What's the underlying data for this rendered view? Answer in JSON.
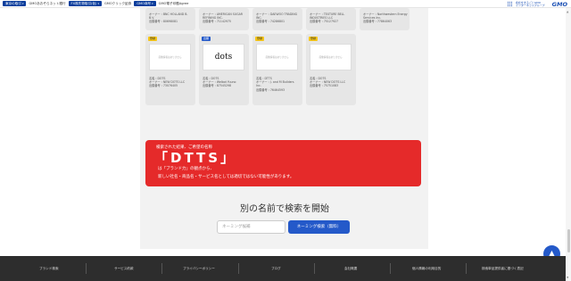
{
  "topbar": {
    "items": [
      {
        "label": "東京の取引",
        "caret": "▾"
      },
      {
        "label": "GMOあおぞらネット銀行",
        "caret": ""
      },
      {
        "label": "FX株先物取引(仮)",
        "caret": "▾"
      },
      {
        "label": "GMOクリック証券",
        "caret": ""
      },
      {
        "label": "GMO商号",
        "caret": "▾"
      },
      {
        "label": "GMO電子印鑑Agree",
        "caret": ""
      }
    ],
    "brand_text_line1": "会社をまるごとGMO",
    "brand_text_line2": "インターネットグループ",
    "brand_logo": "GMO"
  },
  "cards_top": [
    {
      "lines": [
        "オーナー : BNC HOLLAND B.",
        "B.V.",
        "出願番号 : 80698081"
      ]
    },
    {
      "lines": [
        "オーナー : AMERICAN SUGAR",
        "REFINING INC.",
        "出願番号 : 71142975"
      ]
    },
    {
      "lines": [
        "オーナー : DAEWOO TRADING",
        "INC.",
        "出願番号 : 74286801"
      ]
    },
    {
      "lines": [
        "オーナー : TEXTURE BELL",
        "INDUSTRIES LLC",
        "出願番号 : 75127927"
      ]
    },
    {
      "lines": [
        "オーナー : Northwestern Energy",
        "Services Inc.",
        "出願番号 : 77864063"
      ]
    }
  ],
  "cards_bottom": [
    {
      "badge": "登録",
      "badge_color": "yellow",
      "logo": "",
      "lines": [
        "名義 : DOTS",
        "オーナー : NEW DOTS LLC",
        "出願番号 : 73076405"
      ]
    },
    {
      "badge": "出願",
      "badge_color": "blue",
      "logo": "dots",
      "lines": [
        "名義 : DOTS",
        "オーナー : Welbot Yuuno",
        "出願番号 : 87545298"
      ]
    },
    {
      "badge": "登録",
      "badge_color": "yellow",
      "logo": "",
      "lines": [
        "名義 : DTTS",
        "オーナー : J. and M Builders",
        "Inc.",
        "出願番号 : 76464593"
      ]
    },
    {
      "badge": "登録",
      "badge_color": "yellow",
      "logo": "",
      "lines": [
        "名義 : DOTS",
        "オーナー : NEW DOTS LLC",
        "出願番号 : 75751083"
      ]
    }
  ],
  "logo_placeholder": "画像情報はありません",
  "banner": {
    "small": "検索された結果、ご希望の名称",
    "name": "「DTTS」",
    "line1": "は「ブランド力」の観点から、",
    "line2": "新しい社名・商品名・サービス名としては適切ではない可能性があります。"
  },
  "search": {
    "title": "別の名前で検索を開始",
    "placeholder": "ネーミング候補",
    "button": "ネーミング検索（無料）"
  },
  "footer": {
    "items": [
      "ブランド検索",
      "サービス約款",
      "プライバシーポリシー",
      "ブログ",
      "会社概要",
      "個人情報の利用目的",
      "検索単品提供者に基づく表記"
    ]
  },
  "scroll": {
    "up": "▲",
    "down": "▼",
    "back_top": "▲"
  },
  "colors": {
    "banner": "#e52a2a",
    "accent": "#2459c9",
    "footer": "#2d2d2d",
    "badge_registered": "#f5c518"
  }
}
